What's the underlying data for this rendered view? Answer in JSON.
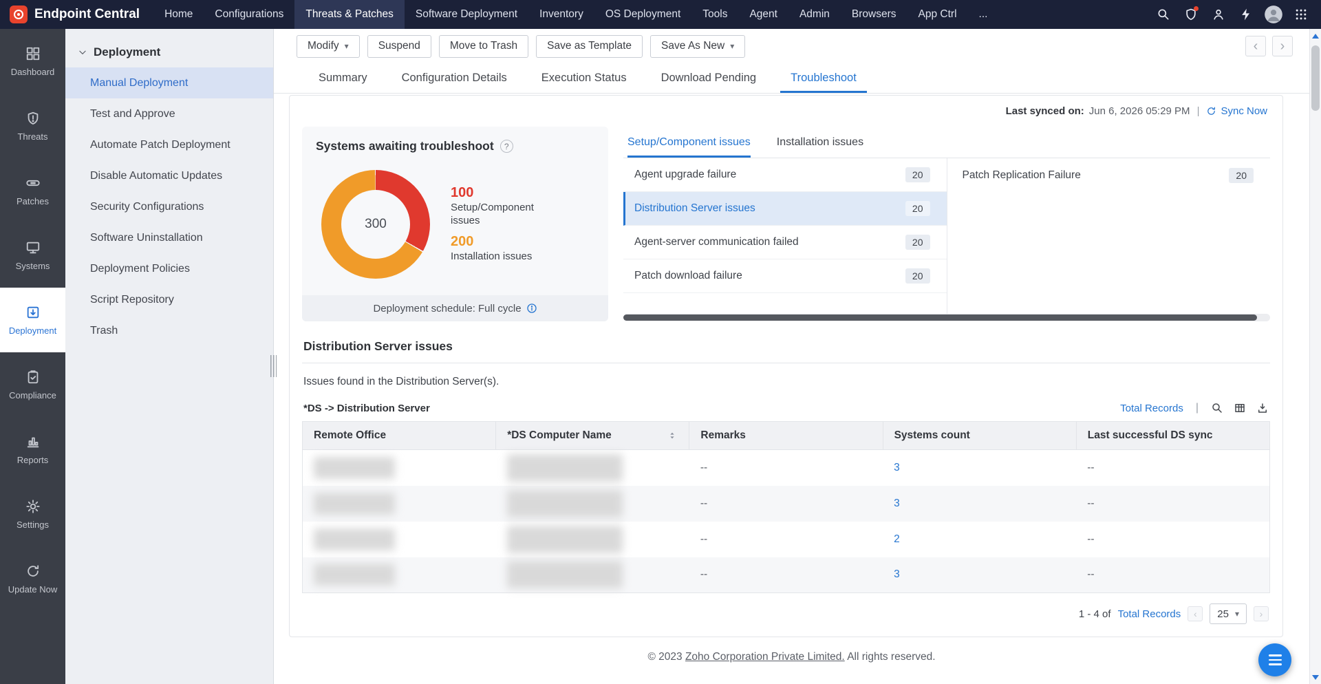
{
  "colors": {
    "topnav_bg": "#1b2138",
    "accent_blue": "#2575d0",
    "danger_red": "#e0392e",
    "warning_orange": "#f09b29"
  },
  "topnav": {
    "brand": "Endpoint Central",
    "items": [
      {
        "label": "Home"
      },
      {
        "label": "Configurations"
      },
      {
        "label": "Threats & Patches"
      },
      {
        "label": "Software Deployment"
      },
      {
        "label": "Inventory"
      },
      {
        "label": "OS Deployment"
      },
      {
        "label": "Tools"
      },
      {
        "label": "Agent"
      },
      {
        "label": "Admin"
      },
      {
        "label": "Browsers"
      },
      {
        "label": "App Ctrl"
      },
      {
        "label": "..."
      }
    ]
  },
  "rail": {
    "items": [
      {
        "label": "Dashboard"
      },
      {
        "label": "Threats"
      },
      {
        "label": "Patches"
      },
      {
        "label": "Systems"
      },
      {
        "label": "Deployment"
      },
      {
        "label": "Compliance"
      },
      {
        "label": "Reports"
      },
      {
        "label": "Settings"
      },
      {
        "label": "Update Now"
      }
    ]
  },
  "sidebar": {
    "header": "Deployment",
    "items": [
      {
        "label": "Manual Deployment"
      },
      {
        "label": "Test and Approve"
      },
      {
        "label": "Automate Patch Deployment"
      },
      {
        "label": "Disable Automatic Updates"
      },
      {
        "label": "Security Configurations"
      },
      {
        "label": "Software Uninstallation"
      },
      {
        "label": "Deployment Policies"
      },
      {
        "label": "Script Repository"
      },
      {
        "label": "Trash"
      }
    ]
  },
  "toolbar": {
    "modify": "Modify",
    "suspend": "Suspend",
    "move_to_trash": "Move to Trash",
    "save_as_template": "Save as Template",
    "save_as_new": "Save As New"
  },
  "tabs": {
    "items": [
      "Summary",
      "Configuration Details",
      "Execution Status",
      "Download Pending",
      "Troubleshoot"
    ]
  },
  "sync": {
    "label": "Last synced on:",
    "value": "Jun 6, 2026 05:29 PM",
    "separator": "|",
    "action": "Sync Now"
  },
  "troubleshoot": {
    "title": "Systems awaiting troubleshoot",
    "help": "?",
    "total": "300",
    "legend": [
      {
        "value": "100",
        "label": "Setup/Component issues"
      },
      {
        "value": "200",
        "label": "Installation issues"
      }
    ],
    "schedule": "Deployment schedule: Full cycle"
  },
  "chart_data": {
    "type": "pie",
    "title": "Systems awaiting troubleshoot",
    "total": 300,
    "slices": [
      {
        "label": "Setup/Component issues",
        "value": 100,
        "color": "#e0392e"
      },
      {
        "label": "Installation issues",
        "value": 200,
        "color": "#f09b29"
      }
    ]
  },
  "issues": {
    "tabs": [
      {
        "label": "Setup/Component issues"
      },
      {
        "label": "Installation issues"
      }
    ],
    "left": [
      {
        "label": "Agent upgrade failure",
        "count": "20"
      },
      {
        "label": "Distribution Server issues",
        "count": "20"
      },
      {
        "label": "Agent-server communication failed",
        "count": "20"
      },
      {
        "label": "Patch download failure",
        "count": "20"
      }
    ],
    "right": [
      {
        "label": "Patch Replication Failure",
        "count": "20"
      }
    ]
  },
  "section": {
    "title": "Distribution Server issues",
    "description": "Issues found in the Distribution Server(s).",
    "table_label": "*DS -> Distribution Server",
    "total_records": "Total Records",
    "separator": "|"
  },
  "table": {
    "columns": [
      "Remote Office",
      "*DS Computer Name",
      "Remarks",
      "Systems count",
      "Last successful DS sync"
    ],
    "rows": [
      {
        "remarks": "--",
        "systems_count": "3",
        "last_sync": "--"
      },
      {
        "remarks": "--",
        "systems_count": "3",
        "last_sync": "--"
      },
      {
        "remarks": "--",
        "systems_count": "2",
        "last_sync": "--"
      },
      {
        "remarks": "--",
        "systems_count": "3",
        "last_sync": "--"
      }
    ]
  },
  "pagination": {
    "range": "1 - 4 of",
    "total_link": "Total Records",
    "page_size": "25"
  },
  "footer": {
    "prefix": "© 2023",
    "link": "Zoho Corporation Private Limited.",
    "suffix": "All rights reserved."
  }
}
